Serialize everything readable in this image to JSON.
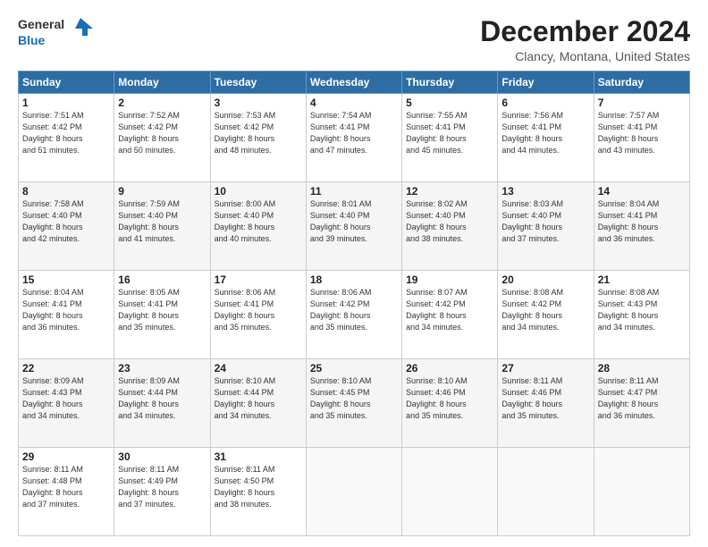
{
  "logo": {
    "line1": "General",
    "line2": "Blue"
  },
  "title": "December 2024",
  "location": "Clancy, Montana, United States",
  "days_header": [
    "Sunday",
    "Monday",
    "Tuesday",
    "Wednesday",
    "Thursday",
    "Friday",
    "Saturday"
  ],
  "weeks": [
    [
      {
        "day": "1",
        "lines": [
          "Sunrise: 7:51 AM",
          "Sunset: 4:42 PM",
          "Daylight: 8 hours",
          "and 51 minutes."
        ]
      },
      {
        "day": "2",
        "lines": [
          "Sunrise: 7:52 AM",
          "Sunset: 4:42 PM",
          "Daylight: 8 hours",
          "and 50 minutes."
        ]
      },
      {
        "day": "3",
        "lines": [
          "Sunrise: 7:53 AM",
          "Sunset: 4:42 PM",
          "Daylight: 8 hours",
          "and 48 minutes."
        ]
      },
      {
        "day": "4",
        "lines": [
          "Sunrise: 7:54 AM",
          "Sunset: 4:41 PM",
          "Daylight: 8 hours",
          "and 47 minutes."
        ]
      },
      {
        "day": "5",
        "lines": [
          "Sunrise: 7:55 AM",
          "Sunset: 4:41 PM",
          "Daylight: 8 hours",
          "and 45 minutes."
        ]
      },
      {
        "day": "6",
        "lines": [
          "Sunrise: 7:56 AM",
          "Sunset: 4:41 PM",
          "Daylight: 8 hours",
          "and 44 minutes."
        ]
      },
      {
        "day": "7",
        "lines": [
          "Sunrise: 7:57 AM",
          "Sunset: 4:41 PM",
          "Daylight: 8 hours",
          "and 43 minutes."
        ]
      }
    ],
    [
      {
        "day": "8",
        "lines": [
          "Sunrise: 7:58 AM",
          "Sunset: 4:40 PM",
          "Daylight: 8 hours",
          "and 42 minutes."
        ]
      },
      {
        "day": "9",
        "lines": [
          "Sunrise: 7:59 AM",
          "Sunset: 4:40 PM",
          "Daylight: 8 hours",
          "and 41 minutes."
        ]
      },
      {
        "day": "10",
        "lines": [
          "Sunrise: 8:00 AM",
          "Sunset: 4:40 PM",
          "Daylight: 8 hours",
          "and 40 minutes."
        ]
      },
      {
        "day": "11",
        "lines": [
          "Sunrise: 8:01 AM",
          "Sunset: 4:40 PM",
          "Daylight: 8 hours",
          "and 39 minutes."
        ]
      },
      {
        "day": "12",
        "lines": [
          "Sunrise: 8:02 AM",
          "Sunset: 4:40 PM",
          "Daylight: 8 hours",
          "and 38 minutes."
        ]
      },
      {
        "day": "13",
        "lines": [
          "Sunrise: 8:03 AM",
          "Sunset: 4:40 PM",
          "Daylight: 8 hours",
          "and 37 minutes."
        ]
      },
      {
        "day": "14",
        "lines": [
          "Sunrise: 8:04 AM",
          "Sunset: 4:41 PM",
          "Daylight: 8 hours",
          "and 36 minutes."
        ]
      }
    ],
    [
      {
        "day": "15",
        "lines": [
          "Sunrise: 8:04 AM",
          "Sunset: 4:41 PM",
          "Daylight: 8 hours",
          "and 36 minutes."
        ]
      },
      {
        "day": "16",
        "lines": [
          "Sunrise: 8:05 AM",
          "Sunset: 4:41 PM",
          "Daylight: 8 hours",
          "and 35 minutes."
        ]
      },
      {
        "day": "17",
        "lines": [
          "Sunrise: 8:06 AM",
          "Sunset: 4:41 PM",
          "Daylight: 8 hours",
          "and 35 minutes."
        ]
      },
      {
        "day": "18",
        "lines": [
          "Sunrise: 8:06 AM",
          "Sunset: 4:42 PM",
          "Daylight: 8 hours",
          "and 35 minutes."
        ]
      },
      {
        "day": "19",
        "lines": [
          "Sunrise: 8:07 AM",
          "Sunset: 4:42 PM",
          "Daylight: 8 hours",
          "and 34 minutes."
        ]
      },
      {
        "day": "20",
        "lines": [
          "Sunrise: 8:08 AM",
          "Sunset: 4:42 PM",
          "Daylight: 8 hours",
          "and 34 minutes."
        ]
      },
      {
        "day": "21",
        "lines": [
          "Sunrise: 8:08 AM",
          "Sunset: 4:43 PM",
          "Daylight: 8 hours",
          "and 34 minutes."
        ]
      }
    ],
    [
      {
        "day": "22",
        "lines": [
          "Sunrise: 8:09 AM",
          "Sunset: 4:43 PM",
          "Daylight: 8 hours",
          "and 34 minutes."
        ]
      },
      {
        "day": "23",
        "lines": [
          "Sunrise: 8:09 AM",
          "Sunset: 4:44 PM",
          "Daylight: 8 hours",
          "and 34 minutes."
        ]
      },
      {
        "day": "24",
        "lines": [
          "Sunrise: 8:10 AM",
          "Sunset: 4:44 PM",
          "Daylight: 8 hours",
          "and 34 minutes."
        ]
      },
      {
        "day": "25",
        "lines": [
          "Sunrise: 8:10 AM",
          "Sunset: 4:45 PM",
          "Daylight: 8 hours",
          "and 35 minutes."
        ]
      },
      {
        "day": "26",
        "lines": [
          "Sunrise: 8:10 AM",
          "Sunset: 4:46 PM",
          "Daylight: 8 hours",
          "and 35 minutes."
        ]
      },
      {
        "day": "27",
        "lines": [
          "Sunrise: 8:11 AM",
          "Sunset: 4:46 PM",
          "Daylight: 8 hours",
          "and 35 minutes."
        ]
      },
      {
        "day": "28",
        "lines": [
          "Sunrise: 8:11 AM",
          "Sunset: 4:47 PM",
          "Daylight: 8 hours",
          "and 36 minutes."
        ]
      }
    ],
    [
      {
        "day": "29",
        "lines": [
          "Sunrise: 8:11 AM",
          "Sunset: 4:48 PM",
          "Daylight: 8 hours",
          "and 37 minutes."
        ]
      },
      {
        "day": "30",
        "lines": [
          "Sunrise: 8:11 AM",
          "Sunset: 4:49 PM",
          "Daylight: 8 hours",
          "and 37 minutes."
        ]
      },
      {
        "day": "31",
        "lines": [
          "Sunrise: 8:11 AM",
          "Sunset: 4:50 PM",
          "Daylight: 8 hours",
          "and 38 minutes."
        ]
      },
      null,
      null,
      null,
      null
    ]
  ]
}
